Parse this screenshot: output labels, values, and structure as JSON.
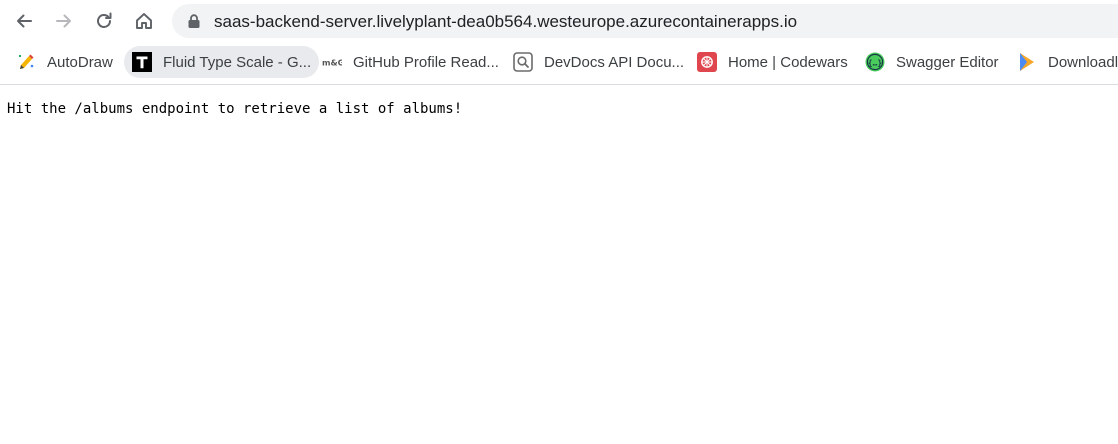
{
  "browser": {
    "url": "saas-backend-server.livelyplant-dea0b564.westeurope.azurecontainerapps.io",
    "nav": {
      "back_icon": "arrow-left-icon",
      "forward_icon": "arrow-right-icon",
      "reload_icon": "reload-icon",
      "home_icon": "home-icon",
      "lock_icon": "lock-icon"
    }
  },
  "bookmarks": [
    {
      "label": "AutoDraw",
      "icon": "pencil-sparkle-icon"
    },
    {
      "label": "Fluid Type Scale - G...",
      "icon": "letter-t-icon",
      "active": true
    },
    {
      "label": "GitHub Profile Read...",
      "icon": "mg-logo-icon"
    },
    {
      "label": "DevDocs API Docu...",
      "icon": "magnifier-box-icon"
    },
    {
      "label": "Home | Codewars",
      "icon": "codewars-icon",
      "color": "#e0464d"
    },
    {
      "label": "Swagger Editor",
      "icon": "swagger-icon",
      "color": "#49cc5c"
    },
    {
      "label": "Downloadl",
      "icon": "download-play-icon"
    }
  ],
  "page": {
    "body_text": "Hit the /albums endpoint to retrieve a list of albums!"
  }
}
